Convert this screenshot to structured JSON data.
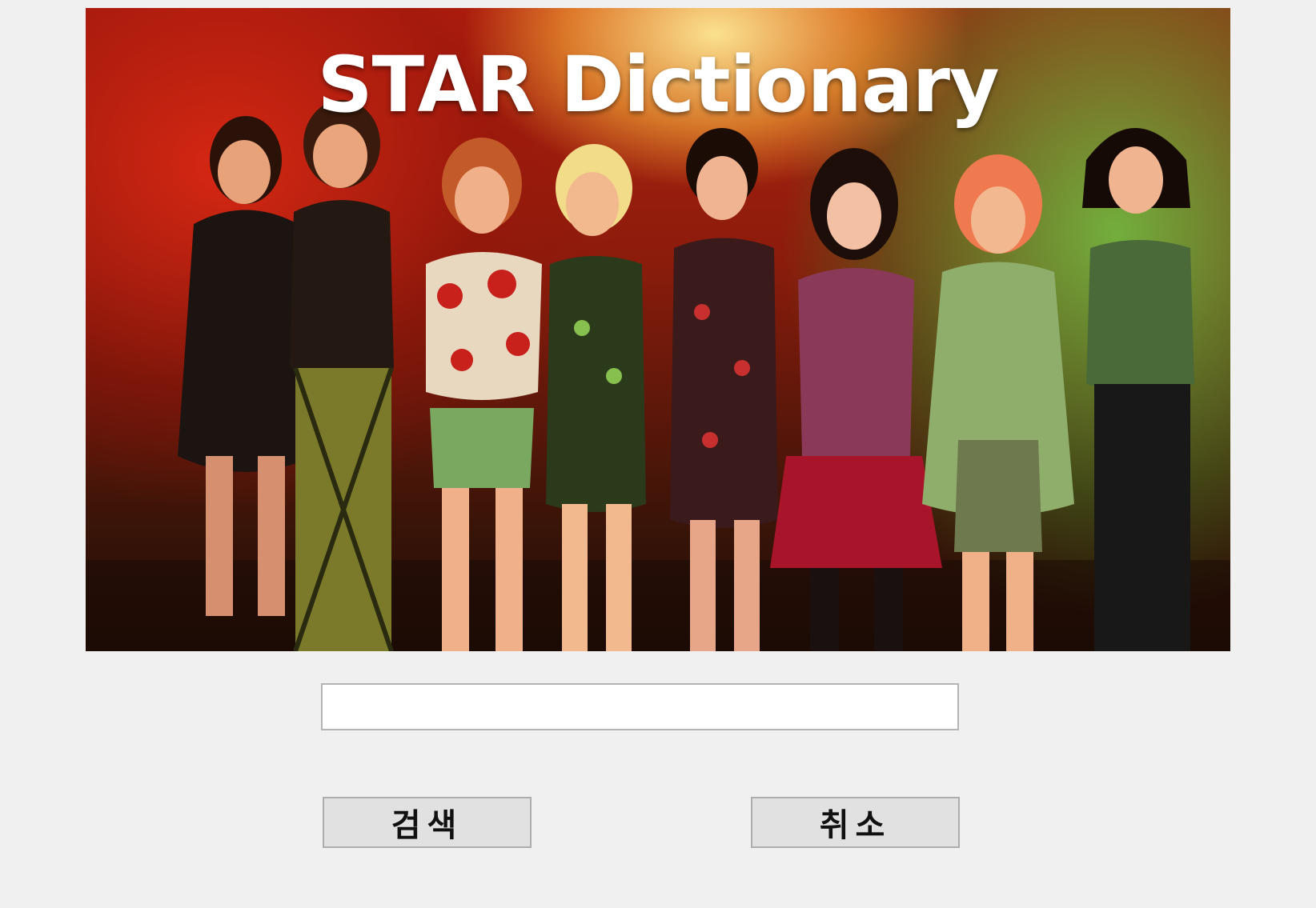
{
  "banner": {
    "title": "STAR Dictionary",
    "image_description_icon": "group-photo-illustration",
    "colors": {
      "warm": "#c8241a",
      "light": "#ffd76a",
      "green": "#6fbf45"
    }
  },
  "search": {
    "value": "",
    "placeholder": ""
  },
  "buttons": {
    "search_label": "검색",
    "cancel_label": "취소"
  },
  "colors": {
    "window_background": "#f0f0f0",
    "button_background": "#e1e1e1",
    "button_border": "#adadad",
    "input_border": "#b4b4b4"
  }
}
